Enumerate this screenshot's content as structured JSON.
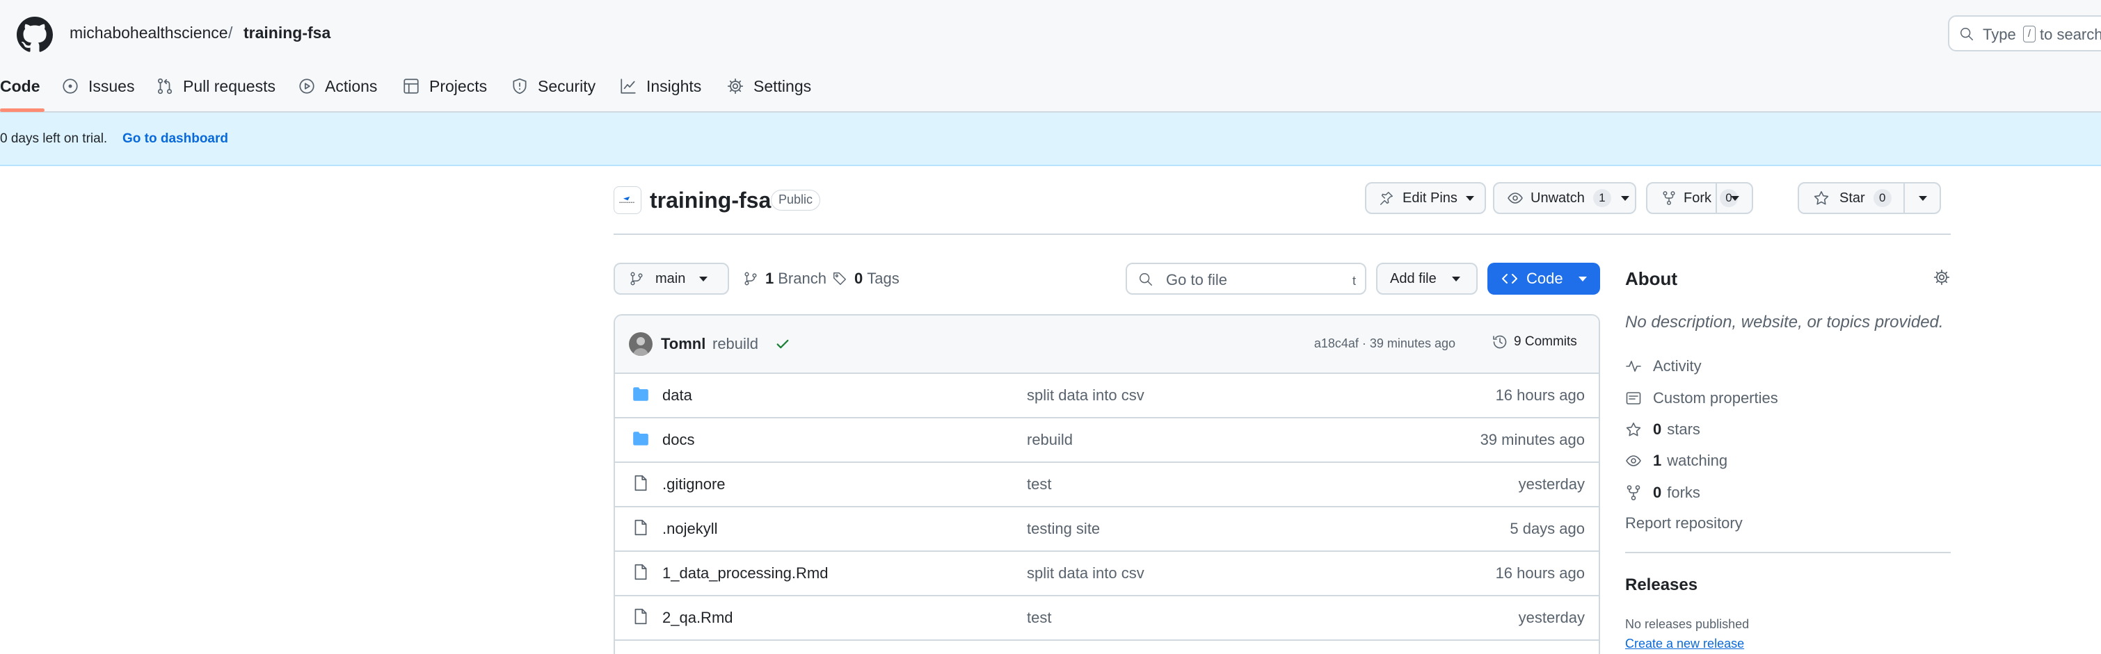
{
  "header": {
    "owner": "michabohealthscience",
    "separator": "/",
    "repo": "training-fsa",
    "search_prefix": "Type",
    "search_key": "/",
    "search_suffix": "to search"
  },
  "tabs": [
    {
      "label": "Code",
      "icon": "code-icon",
      "active": true
    },
    {
      "label": "Issues",
      "icon": "issue-icon"
    },
    {
      "label": "Pull requests",
      "icon": "pull-request-icon"
    },
    {
      "label": "Actions",
      "icon": "play-icon"
    },
    {
      "label": "Projects",
      "icon": "table-icon"
    },
    {
      "label": "Security",
      "icon": "shield-icon"
    },
    {
      "label": "Insights",
      "icon": "graph-icon"
    },
    {
      "label": "Settings",
      "icon": "gear-icon"
    }
  ],
  "banner": {
    "text": "0 days left on trial.",
    "link": "Go to dashboard"
  },
  "repo": {
    "name": "training-fsa",
    "visibility": "Public",
    "edit_pins": "Edit Pins",
    "unwatch": "Unwatch",
    "watch_count": "1",
    "fork": "Fork",
    "fork_count": "0",
    "star": "Star",
    "star_count": "0"
  },
  "toolbar": {
    "branch": "main",
    "branch_count": "1",
    "branch_label": "Branch",
    "tag_count": "0",
    "tag_label": "Tags",
    "goto_placeholder": "Go to file",
    "goto_shortcut": "t",
    "add_file": "Add file",
    "code": "Code"
  },
  "commit": {
    "author": "Tomnl",
    "message": "rebuild",
    "hash_time": "a18c4af · 39 minutes ago",
    "commits": "9 Commits"
  },
  "files": [
    {
      "name": "data",
      "type": "folder",
      "message": "split data into csv",
      "date": "16 hours ago"
    },
    {
      "name": "docs",
      "type": "folder",
      "message": "rebuild",
      "date": "39 minutes ago"
    },
    {
      "name": ".gitignore",
      "type": "file",
      "message": "test",
      "date": "yesterday"
    },
    {
      "name": ".nojekyll",
      "type": "file",
      "message": "testing site",
      "date": "5 days ago"
    },
    {
      "name": "1_data_processing.Rmd",
      "type": "file",
      "message": "split data into csv",
      "date": "16 hours ago"
    },
    {
      "name": "2_qa.Rmd",
      "type": "file",
      "message": "test",
      "date": "yesterday"
    }
  ],
  "about": {
    "heading": "About",
    "description": "No description, website, or topics provided.",
    "activity": "Activity",
    "custom_properties": "Custom properties",
    "stars_count": "0",
    "stars_label": "stars",
    "watching_count": "1",
    "watching_label": "watching",
    "forks_count": "0",
    "forks_label": "forks",
    "report": "Report repository"
  },
  "releases": {
    "heading": "Releases",
    "none": "No releases published",
    "create": "Create a new release"
  },
  "colors": {
    "accent": "#0969da",
    "primary_button": "#1f6feb",
    "banner_bg": "#ddf4ff",
    "folder": "#54aeff",
    "success": "#1a7f37",
    "tab_underline": "#fd8c73"
  }
}
